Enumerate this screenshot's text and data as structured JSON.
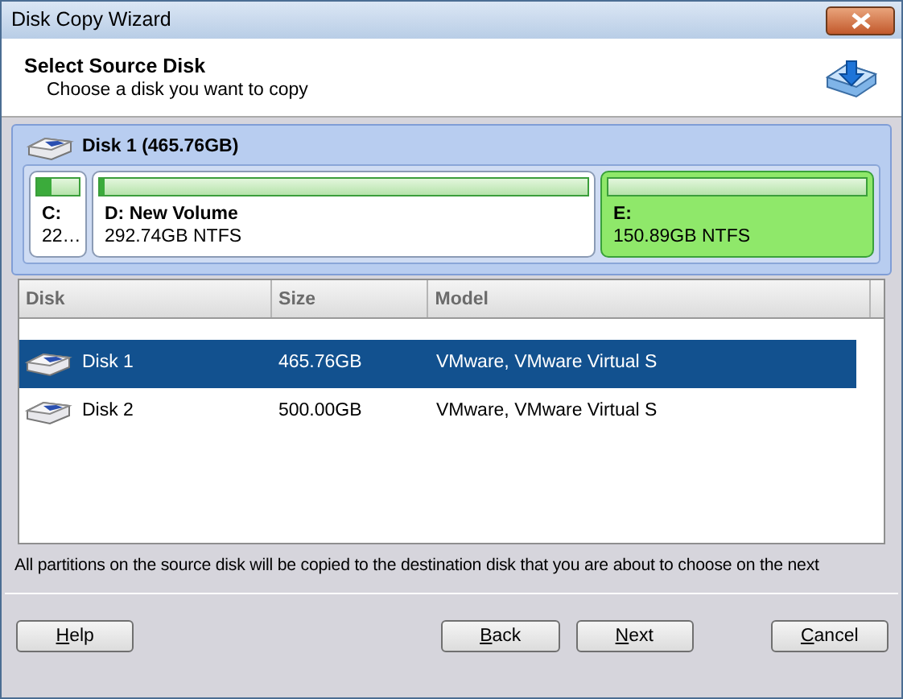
{
  "window": {
    "title": "Disk Copy Wizard"
  },
  "header": {
    "title": "Select Source Disk",
    "subtitle": "Choose a disk you want to copy"
  },
  "disk_map": {
    "title": "Disk 1 (465.76GB)",
    "partitions": [
      {
        "label": "C:",
        "detail": "22…",
        "level": 0.35,
        "selected": false
      },
      {
        "label": "D: New Volume",
        "detail": "292.74GB NTFS",
        "level": 0.01,
        "selected": false
      },
      {
        "label": "E:",
        "detail": "150.89GB NTFS",
        "level": 0,
        "selected": true
      }
    ]
  },
  "table": {
    "columns": [
      "Disk",
      "Size",
      "Model"
    ],
    "rows": [
      {
        "disk": "Disk 1",
        "size": "465.76GB",
        "model": "VMware, VMware Virtual S",
        "selected": true
      },
      {
        "disk": "Disk 2",
        "size": "500.00GB",
        "model": "VMware, VMware Virtual S",
        "selected": false
      }
    ]
  },
  "note": "All partitions on the source disk will be copied to the destination disk that you are about to choose on the next",
  "buttons": [
    {
      "label": "Help",
      "first_letter_underlined": true
    },
    {
      "label": "Back",
      "first_letter_underlined": true
    },
    {
      "label": "Next",
      "first_letter_underlined": true
    },
    {
      "label": "Cancel",
      "first_letter_underlined": true
    }
  ]
}
